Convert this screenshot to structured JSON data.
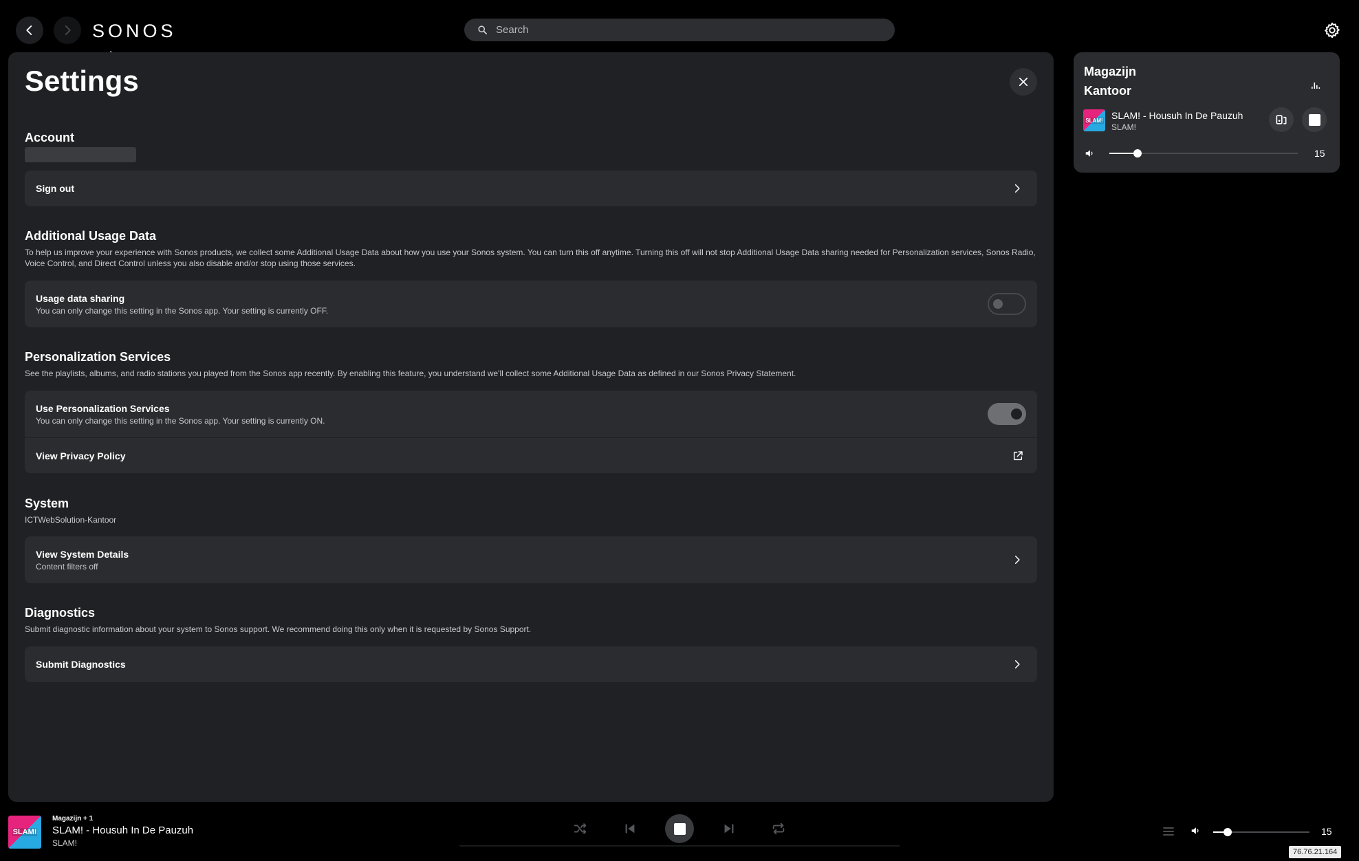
{
  "app": {
    "logo": "SONOS"
  },
  "search": {
    "placeholder": "Search"
  },
  "settings": {
    "title": "Settings",
    "account": {
      "title": "Account",
      "sign_out_label": "Sign out"
    },
    "usage": {
      "title": "Additional Usage Data",
      "description": "To help us improve your experience with Sonos products, we collect some Additional Usage Data about how you use your Sonos system. You can turn this off anytime. Turning this off will not stop Additional Usage Data sharing needed for Personalization services, Sonos Radio, Voice Control, and Direct Control unless you also disable and/or stop using those services.",
      "row_label": "Usage data sharing",
      "row_sub": "You can only change this setting in the Sonos app. Your setting is currently OFF.",
      "enabled": false
    },
    "personalization": {
      "title": "Personalization Services",
      "description": "See the playlists, albums, and radio stations you played from the Sonos app recently. By enabling this feature, you understand we'll collect some Additional Usage Data as defined in our Sonos Privacy Statement.",
      "row_label": "Use Personalization Services",
      "row_sub": "You can only change this setting in the Sonos app. Your setting is currently ON.",
      "enabled": true,
      "privacy_label": "View Privacy Policy"
    },
    "system": {
      "title": "System",
      "name": "ICTWebSolution-Kantoor",
      "details_label": "View System Details",
      "details_sub": "Content filters off"
    },
    "diagnostics": {
      "title": "Diagnostics",
      "description": "Submit diagnostic information about your system to Sonos support. We recommend doing this only when it is requested by Sonos Support.",
      "submit_label": "Submit Diagnostics"
    }
  },
  "now_playing_card": {
    "room1": "Magazijn",
    "room2": "Kantoor",
    "art_text": "SLAM!",
    "track": "SLAM! - Housuh In De Pauzuh",
    "station": "SLAM!",
    "volume": 15
  },
  "player": {
    "room": "Magazijn + 1",
    "track": "SLAM! - Housuh In De Pauzuh",
    "station": "SLAM!",
    "art_text": "SLAM!",
    "volume": 15,
    "ip": "76.76.21.164"
  },
  "colors": {
    "background": "#000000",
    "panel": "#202124",
    "card": "#2b2c2f",
    "art_pink": "#e7247d",
    "art_blue": "#27a9e1"
  },
  "icons": [
    "back-icon",
    "forward-icon",
    "search-icon",
    "gear-icon",
    "close-icon",
    "chevron-right-icon",
    "external-link-icon",
    "equalizer-icon",
    "group-icon",
    "stop-icon",
    "volume-icon",
    "shuffle-icon",
    "previous-icon",
    "next-icon",
    "repeat-icon",
    "queue-icon"
  ]
}
